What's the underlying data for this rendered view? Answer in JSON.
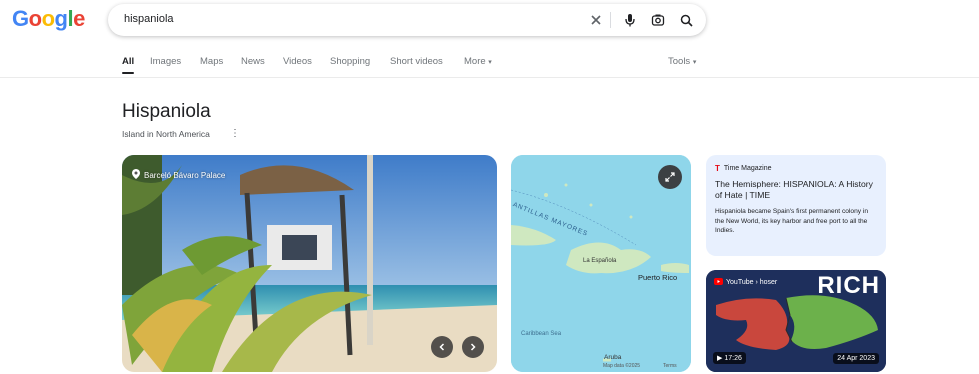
{
  "logo": {
    "letters": [
      "G",
      "o",
      "o",
      "g",
      "l",
      "e"
    ],
    "colors": [
      "#4285f4",
      "#ea4335",
      "#fbbc05",
      "#4285f4",
      "#34a853",
      "#ea4335"
    ]
  },
  "search": {
    "query": "hispaniola"
  },
  "tabs": [
    {
      "label": "All",
      "active": true
    },
    {
      "label": "Images"
    },
    {
      "label": "Maps"
    },
    {
      "label": "News"
    },
    {
      "label": "Videos"
    },
    {
      "label": "Shopping"
    },
    {
      "label": "Short videos"
    },
    {
      "label": "More"
    }
  ],
  "tools_label": "Tools",
  "entity": {
    "title": "Hispaniola",
    "subtitle": "Island in North America"
  },
  "photo": {
    "place": "Barceló Bávaro Palace"
  },
  "map": {
    "labels": {
      "antillas": "ANTILLAS MAYORES",
      "island": "La Española",
      "puerto_rico": "Puerto Rico",
      "sea": "Caribbean Sea",
      "aruba": "Aruba",
      "attribution": "Map data ©2025",
      "terms": "Terms"
    }
  },
  "article": {
    "source": "Time Magazine",
    "title": "The Hemisphere: HISPANIOLA: A History of Hate | TIME",
    "snippet": "Hispaniola became Spain's first permanent colony in the New World, its key harbor and free port to all the Indies."
  },
  "video": {
    "source": "YouTube › hoser",
    "overlay_text": "RICH",
    "duration": "17:26",
    "date": "24 Apr 2023"
  },
  "colors": {
    "accent_blue": "#1a73e8",
    "card_bg": "#e8f0fe",
    "ocean": "#8fd6ea",
    "land": "#cfe8c0"
  }
}
